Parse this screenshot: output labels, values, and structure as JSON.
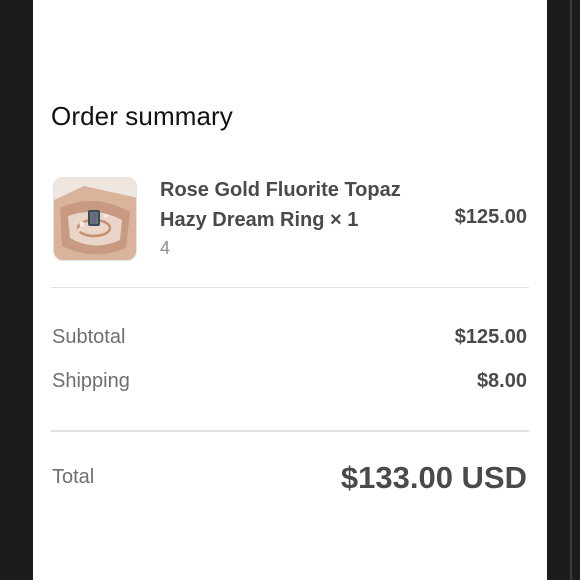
{
  "order_summary": {
    "title": "Order summary",
    "item": {
      "name": "Rose Gold Fluorite Topaz Hazy Dream Ring × 1",
      "variant": "4",
      "price": "$125.00",
      "image_icon": "ring-product-image"
    },
    "subtotal": {
      "label": "Subtotal",
      "value": "$125.00"
    },
    "shipping": {
      "label": "Shipping",
      "value": "$8.00"
    },
    "total": {
      "label": "Total",
      "value": "$133.00 USD"
    }
  },
  "colors": {
    "page_background": "#1c1c1e",
    "panel_background": "#ffffff",
    "text_primary": "#4a4a4a",
    "text_secondary": "#6f6f6f",
    "divider": "#e0e0e0"
  }
}
